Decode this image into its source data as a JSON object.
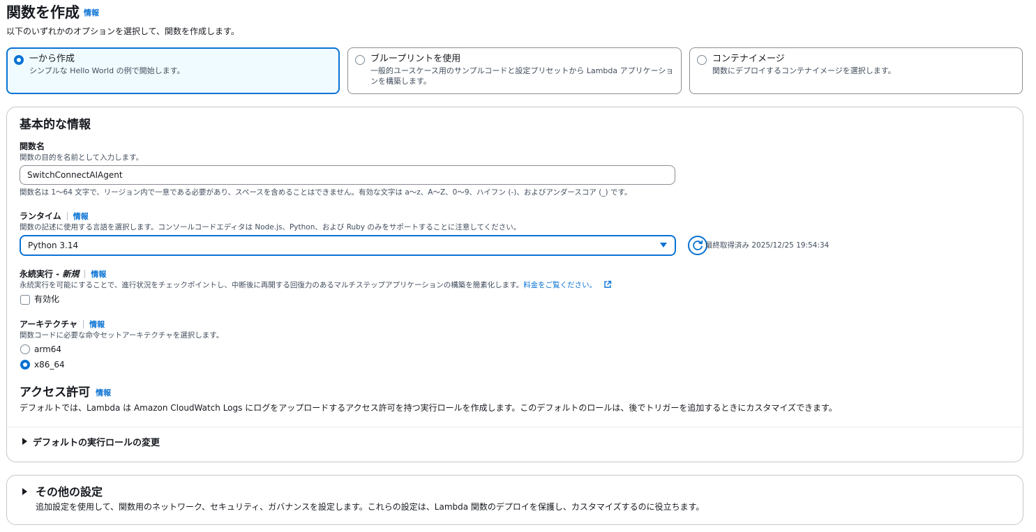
{
  "header": {
    "title": "関数を作成",
    "info": "情報",
    "description": "以下のいずれかのオプションを選択して、関数を作成します。"
  },
  "options": [
    {
      "title": "一から作成",
      "description": "シンプルな Hello World の例で開始します。",
      "selected": true
    },
    {
      "title": "ブループリントを使用",
      "description": "一般的ユースケース用のサンプルコードと設定プリセットから Lambda アプリケーションを構築します。",
      "selected": false
    },
    {
      "title": "コンテナイメージ",
      "description": "関数にデプロイするコンテナイメージを選択します。",
      "selected": false
    }
  ],
  "basic": {
    "heading": "基本的な情報",
    "function_name": {
      "label": "関数名",
      "description": "関数の目的を名前として入力します。",
      "value": "SwitchConnectAIAgent",
      "constraint": "関数名は 1〜64 文字で、リージョン内で一意である必要があり、スペースを含めることはできません。有効な文字は a〜z、A〜Z、0〜9、ハイフン (-)、およびアンダースコア (_) です。"
    },
    "runtime": {
      "label": "ランタイム",
      "info": "情報",
      "description": "関数の記述に使用する言語を選択します。コンソールコードエディタは Node.js、Python、および Ruby のみをサポートすることに注意してください。",
      "value": "Python 3.14",
      "fetched_label": "最終取得済み 2025/12/25 19:54:34"
    },
    "durable": {
      "label": "永続実行 - ",
      "label_new": "新規",
      "info": "情報",
      "description": "永続実行を可能にすることで、進行状況をチェックポイントし、中断後に再開する回復力のあるマルチステップアプリケーションの構築を簡素化します。",
      "pricing_link": "料金をご覧ください。",
      "checkbox_label": "有効化",
      "checked": false
    },
    "architecture": {
      "label": "アーキテクチャ",
      "info": "情報",
      "description": "関数コードに必要な命令セットアーキテクチャを選択します。",
      "options": [
        "arm64",
        "x86_64"
      ],
      "selected": "x86_64"
    },
    "permissions": {
      "heading": "アクセス許可",
      "info": "情報",
      "description": "デフォルトでは、Lambda は Amazon CloudWatch Logs にログをアップロードするアクセス許可を持つ実行ロールを作成します。このデフォルトのロールは、後でトリガーを追加するときにカスタマイズできます。"
    },
    "role_expander": "デフォルトの実行ロールの変更"
  },
  "other": {
    "heading": "その他の設定",
    "description": "追加設定を使用して、関数用のネットワーク、セキュリティ、ガバナンスを設定します。これらの設定は、Lambda 関数のデプロイを保護し、カスタマイズするのに役立ちます。"
  },
  "colors": {
    "accent": "#0972d3",
    "text": "#16191f",
    "muted": "#414d5c",
    "selected_bg": "#f0fbff"
  }
}
